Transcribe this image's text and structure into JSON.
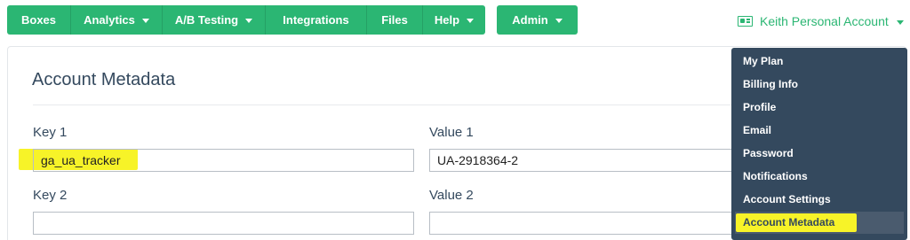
{
  "nav": {
    "main_items": [
      {
        "label": "Boxes",
        "has_caret": false
      },
      {
        "label": "Analytics",
        "has_caret": true
      },
      {
        "label": "A/B Testing",
        "has_caret": true
      },
      {
        "label": "Integrations",
        "has_caret": false
      },
      {
        "label": "Files",
        "has_caret": false
      },
      {
        "label": "Help",
        "has_caret": true
      }
    ],
    "admin_label": "Admin",
    "account_label": "Keith Personal Account",
    "account_icon": "id-card-icon"
  },
  "panel": {
    "title": "Account Metadata",
    "rows": [
      {
        "key_label": "Key 1",
        "key_value": "ga_ua_tracker",
        "value_label": "Value 1",
        "value_value": "UA-2918364-2"
      },
      {
        "key_label": "Key 2",
        "key_value": "",
        "value_label": "Value 2",
        "value_value": ""
      }
    ]
  },
  "dropdown": {
    "items": [
      "My Plan",
      "Billing Info",
      "Profile",
      "Email",
      "Password",
      "Notifications",
      "Account Settings",
      "Account Metadata"
    ],
    "active_item": "Account Metadata"
  },
  "colors": {
    "brand_green": "#2bb673",
    "dropdown_bg": "#34495e",
    "highlight": "#f7f328",
    "text": "#34495e"
  }
}
